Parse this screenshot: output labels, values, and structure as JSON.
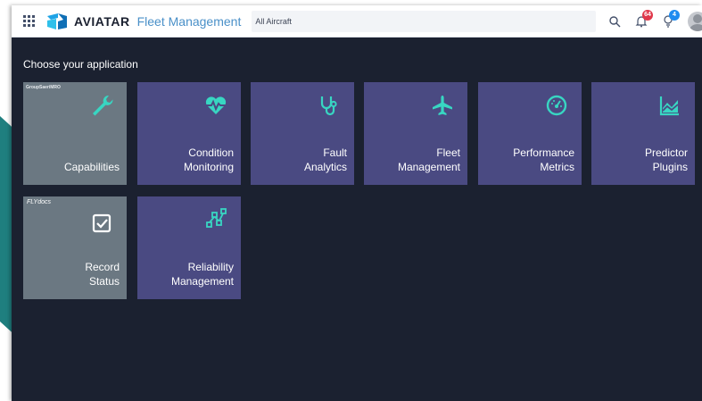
{
  "topbar": {
    "brand": "AVIATAR",
    "product": "Fleet Management",
    "aircraft_filter": "All Aircraft",
    "notifications_count": "64",
    "ideas_count": "4"
  },
  "main": {
    "heading": "Choose your application"
  },
  "tiles": [
    {
      "label": "Capabilities",
      "icon": "wrench-icon",
      "tag": "GroupSaeriMRO"
    },
    {
      "label": "Condition\nMonitoring",
      "icon": "heartbeat-icon"
    },
    {
      "label": "Fault\nAnalytics",
      "icon": "stethoscope-icon"
    },
    {
      "label": "Fleet\nManagement",
      "icon": "airplane-icon"
    },
    {
      "label": "Performance\nMetrics",
      "icon": "gauge-icon"
    },
    {
      "label": "Predictor\nPlugins",
      "icon": "chart-icon"
    },
    {
      "label": "Record\nStatus",
      "icon": "checkbox-icon",
      "tag": "FLYdocs"
    },
    {
      "label": "Reliability\nManagement",
      "icon": "nodes-icon"
    }
  ],
  "colors": {
    "tile_purple": "#4a4a82",
    "tile_grey": "#6b7882",
    "icon_teal": "#38d6c2",
    "background": "#1b2130",
    "badge_red": "#e0384b",
    "badge_blue": "#1f8cf0"
  }
}
